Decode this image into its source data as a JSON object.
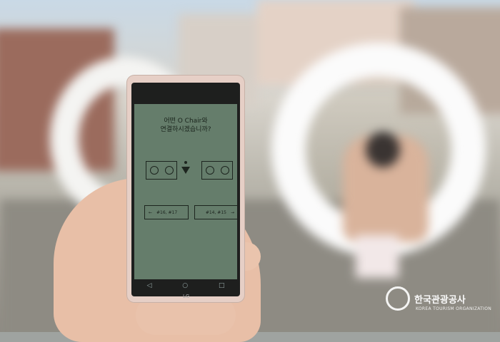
{
  "phone": {
    "prompt_line1": "어떤 O Chair와",
    "prompt_line2": "연결하시겠습니까?",
    "left_button": "#16, #17",
    "right_button": "#14, #15",
    "brand": "LG"
  },
  "watermark": {
    "title": "한국관광공사",
    "subtitle": "KOREA TOURISM ORGANIZATION"
  }
}
